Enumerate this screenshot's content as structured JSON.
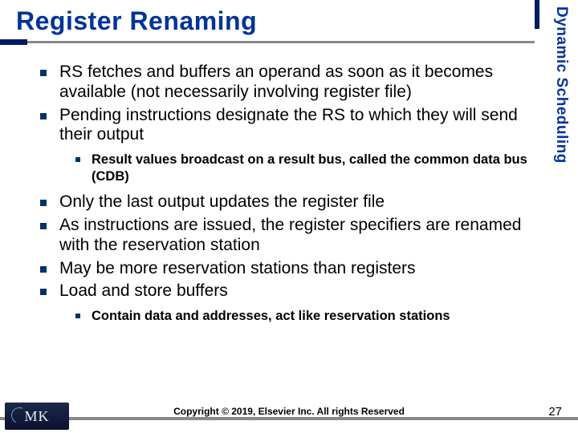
{
  "title": "Register Renaming",
  "sidebar_label": "Dynamic Scheduling",
  "bullets": [
    {
      "text": "RS fetches and buffers an operand as soon as it becomes available (not necessarily involving register file)"
    },
    {
      "text": "Pending instructions designate the RS to which they will send their output",
      "sub": [
        {
          "text": "Result values broadcast on a result bus, called the common data bus (CDB)"
        }
      ]
    },
    {
      "text": "Only the last output updates the register file"
    },
    {
      "text": "As instructions are issued, the register specifiers are renamed with the reservation station"
    },
    {
      "text": "May be more reservation stations than registers"
    },
    {
      "text": "Load and store buffers",
      "sub": [
        {
          "text": "Contain data and addresses, act like reservation stations"
        }
      ]
    }
  ],
  "footer": {
    "copyright": "Copyright © 2019, Elsevier Inc. All rights Reserved",
    "page": "27"
  },
  "logo_text": "MK"
}
